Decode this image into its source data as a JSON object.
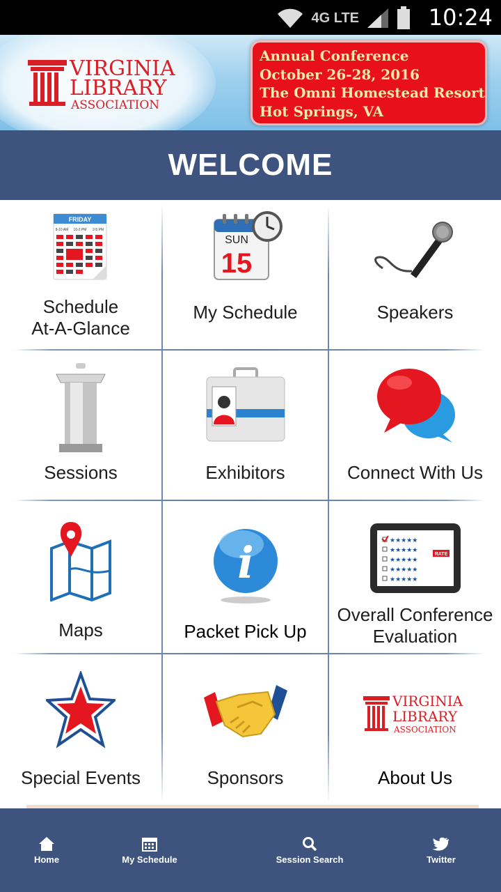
{
  "status_bar": {
    "time": "10:24",
    "network": "4G LTE",
    "icons": [
      "wifi-icon",
      "signal-icon",
      "battery-icon"
    ]
  },
  "banner": {
    "logo_lines": [
      "VIRGINIA",
      "LIBRARY",
      "ASSOCIATION"
    ],
    "info_lines": [
      "Annual Conference",
      "October 26-28, 2016",
      "The Omni Homestead Resort",
      "Hot Springs, VA"
    ]
  },
  "header": {
    "title": "WELCOME"
  },
  "tiles": [
    {
      "label_1": "Schedule",
      "label_2": "At-A-Glance",
      "icon": "calendar-grid-icon",
      "cal_day": "FRIDAY",
      "cal_times": [
        "8-10 AM",
        "10-2 PM",
        "2-5 PM"
      ]
    },
    {
      "label_1": "My Schedule",
      "label_2": "",
      "icon": "calendar-clock-icon",
      "cal_day": "SUN",
      "cal_date": "15"
    },
    {
      "label_1": "Speakers",
      "label_2": "",
      "icon": "microphone-icon"
    },
    {
      "label_1": "Sessions",
      "label_2": "",
      "icon": "podium-icon"
    },
    {
      "label_1": "Exhibitors",
      "label_2": "",
      "icon": "id-badge-icon"
    },
    {
      "label_1": "Connect With Us",
      "label_2": "",
      "icon": "speech-bubbles-icon"
    },
    {
      "label_1": "Maps",
      "label_2": "",
      "icon": "map-pin-icon"
    },
    {
      "label_1": "Packet Pick Up",
      "label_2": "",
      "icon": "info-icon",
      "glyph": "i"
    },
    {
      "label_1": "Overall Conference",
      "label_2": "Evaluation",
      "icon": "tablet-rating-icon",
      "badge": "RATE"
    },
    {
      "label_1": "Special Events",
      "label_2": "",
      "icon": "star-icon"
    },
    {
      "label_1": "Sponsors",
      "label_2": "",
      "icon": "handshake-icon"
    },
    {
      "label_1": "About Us",
      "label_2": "",
      "icon": "vla-logo-icon"
    }
  ],
  "bottom_nav": [
    {
      "label": "Home",
      "icon": "home-icon"
    },
    {
      "label": "My Schedule",
      "icon": "calendar-icon"
    },
    {
      "label": "Session Search",
      "icon": "search-icon"
    },
    {
      "label": "Twitter",
      "icon": "twitter-bird-icon"
    }
  ],
  "colors": {
    "nav_blue": "#3e547e",
    "banner_red": "#e8101a",
    "banner_text": "#f6e8a8",
    "logo_red": "#d81f26"
  }
}
